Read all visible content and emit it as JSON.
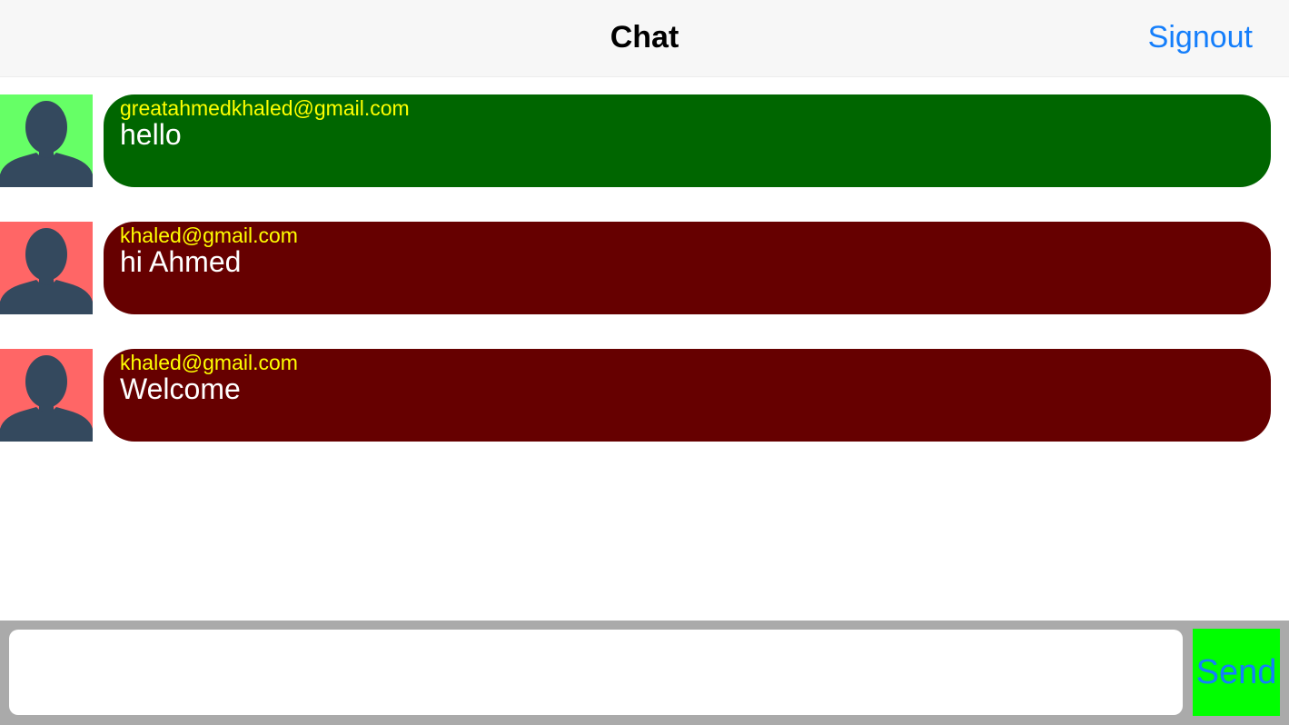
{
  "navbar": {
    "title": "Chat",
    "signout_label": "Signout"
  },
  "messages": [
    {
      "sender": "greatahmedkhaled@gmail.com",
      "text": "hello",
      "bubble_color": "#006600",
      "avatar_bg": "#66ff66",
      "avatar_icon": "person-silhouette-icon"
    },
    {
      "sender": "khaled@gmail.com",
      "text": "hi Ahmed",
      "bubble_color": "#660000",
      "avatar_bg": "#ff6666",
      "avatar_icon": "person-silhouette-icon"
    },
    {
      "sender": "khaled@gmail.com",
      "text": "Welcome",
      "bubble_color": "#660000",
      "avatar_bg": "#ff6666",
      "avatar_icon": "person-silhouette-icon"
    }
  ],
  "composer": {
    "input_value": "",
    "send_label": "Send"
  },
  "colors": {
    "accent": "#147efb",
    "sender_text": "#ffff00",
    "message_text": "#ffffff",
    "send_bg": "#00ff00",
    "inputbar_bg": "#aaaaaa",
    "silhouette": "#34495e"
  }
}
